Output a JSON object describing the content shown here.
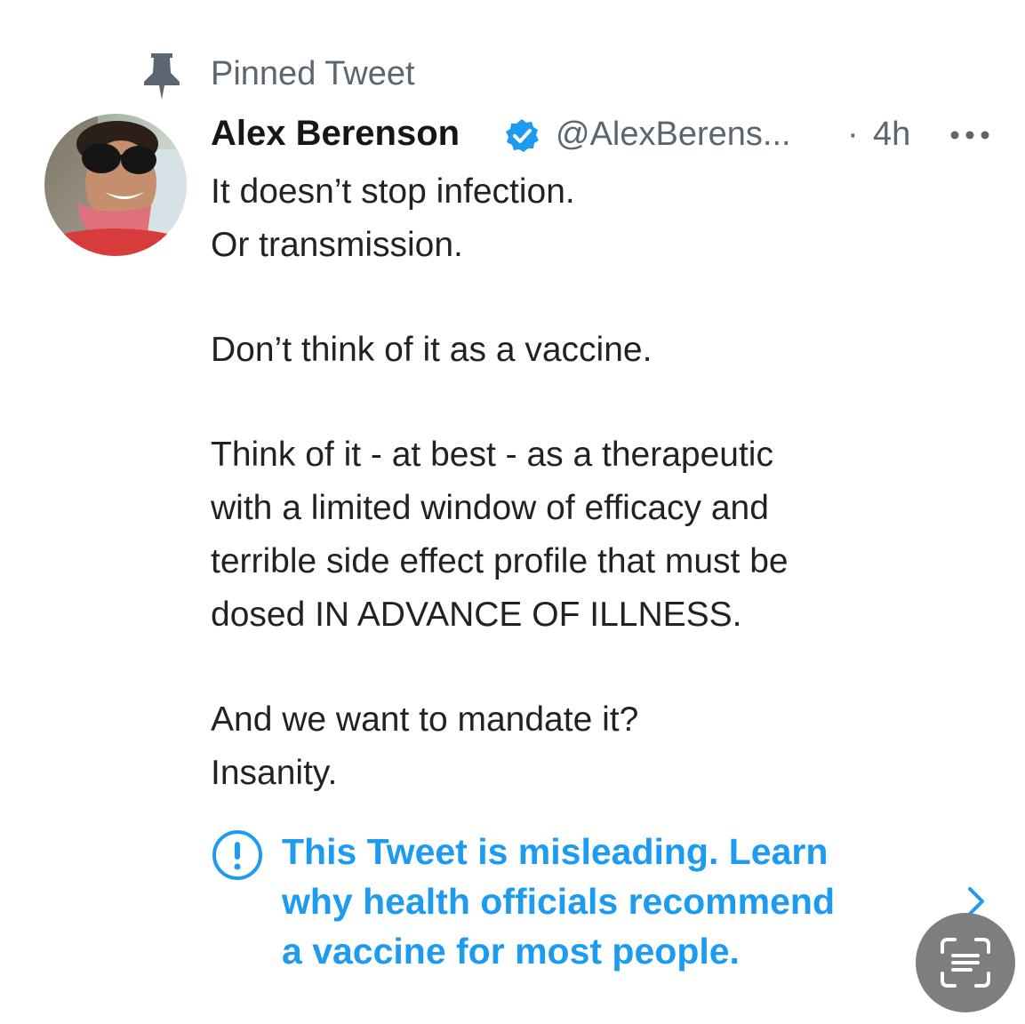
{
  "pinned": {
    "label": "Pinned Tweet",
    "icon": "pin-icon"
  },
  "tweet": {
    "author": {
      "name": "Alex Berenson",
      "handle": "@AlexBerens...",
      "verified": true,
      "avatar": "profile-photo"
    },
    "separator": "·",
    "timestamp": "4h",
    "more_icon": "more-icon",
    "body": {
      "lines": [
        "It doesn’t stop infection.",
        "Or transmission.",
        "",
        "Don’t think of it as a vaccine.",
        "",
        "Think of it - at best - as a therapeutic",
        "with a limited window of efficacy and",
        "terrible side effect profile that must be",
        "dosed IN ADVANCE OF ILLNESS.",
        "",
        "And we want to mandate it?",
        "Insanity."
      ]
    },
    "notice": {
      "icon": "exclamation-circle-icon",
      "lines": [
        "This Tweet is misleading. Learn",
        "why health officials recommend",
        "a vaccine for most people."
      ],
      "chevron": "chevron-right-icon"
    }
  },
  "overlay": {
    "scan_button_icon": "live-text-scan-icon"
  },
  "colors": {
    "text_primary": "#14171a",
    "text_secondary": "#5b6670",
    "accent_blue": "#1d9bf0",
    "overlay_gray": "#7d7e80"
  }
}
